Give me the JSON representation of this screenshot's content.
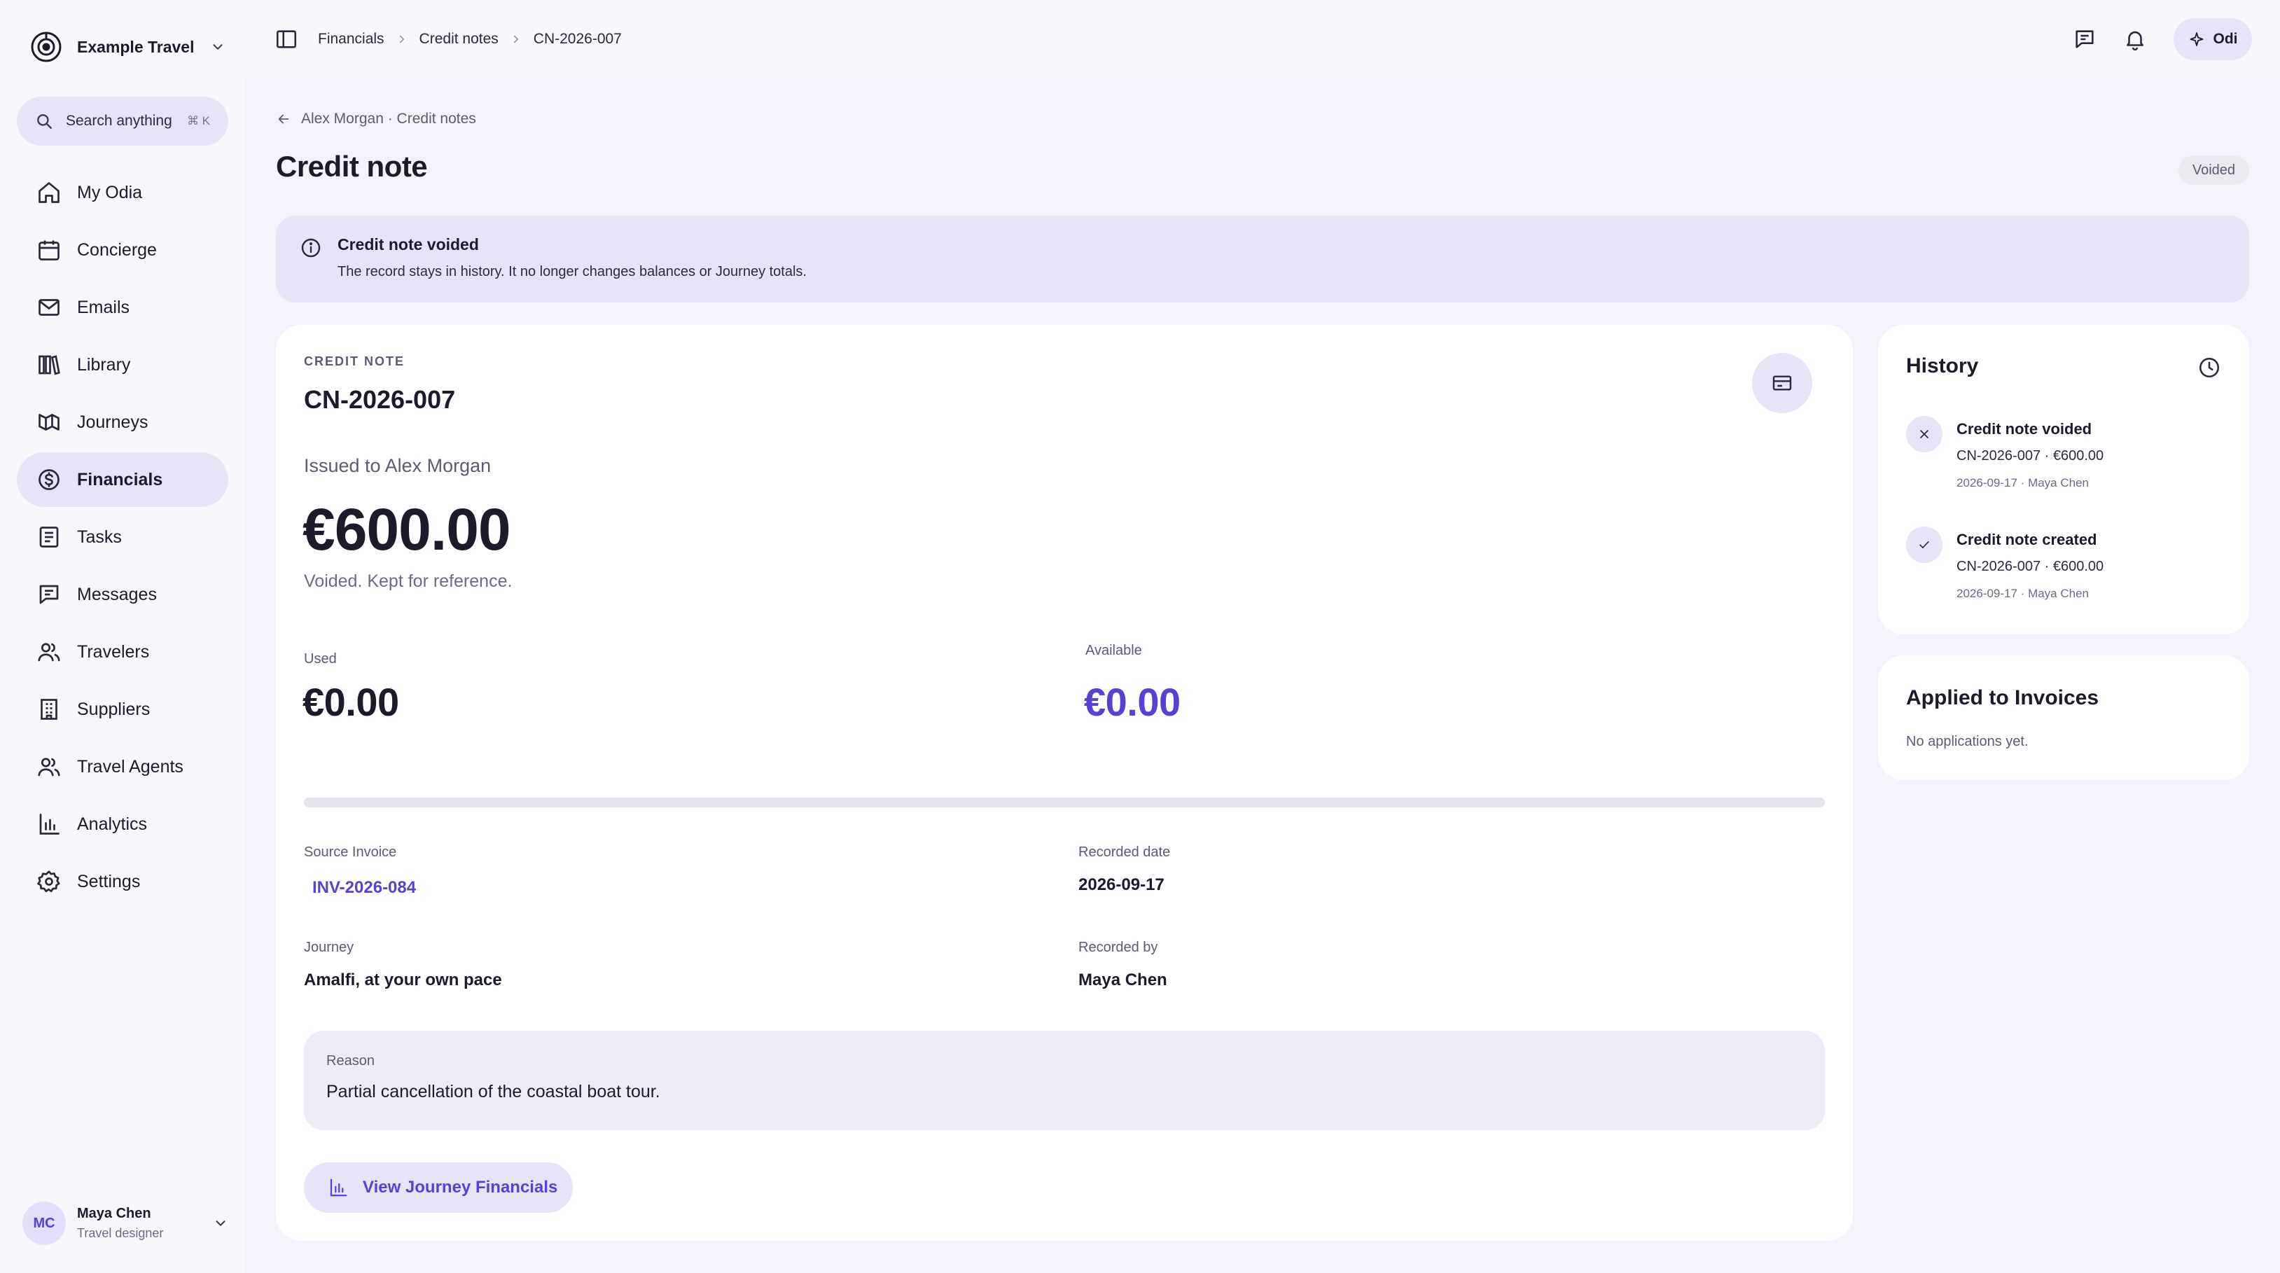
{
  "sidebar": {
    "brand": "Example Travel",
    "search": {
      "placeholder": "Search anything",
      "shortcut": "⌘ K"
    },
    "items": [
      {
        "label": "My Odia",
        "icon": "home-icon",
        "active": false
      },
      {
        "label": "Concierge",
        "icon": "calendar-icon",
        "active": false
      },
      {
        "label": "Emails",
        "icon": "mail-icon",
        "active": false
      },
      {
        "label": "Library",
        "icon": "library-icon",
        "active": false
      },
      {
        "label": "Journeys",
        "icon": "journeys-icon",
        "active": false
      },
      {
        "label": "Financials",
        "icon": "dollar-icon",
        "active": true
      },
      {
        "label": "Tasks",
        "icon": "tasks-icon",
        "active": false
      },
      {
        "label": "Messages",
        "icon": "message-icon",
        "active": false
      },
      {
        "label": "Travelers",
        "icon": "users-icon",
        "active": false
      },
      {
        "label": "Suppliers",
        "icon": "building-icon",
        "active": false
      },
      {
        "label": "Travel Agents",
        "icon": "agents-icon",
        "active": false
      },
      {
        "label": "Analytics",
        "icon": "bar-chart-icon",
        "active": false
      },
      {
        "label": "Settings",
        "icon": "gear-icon",
        "active": false
      }
    ],
    "user": {
      "initials": "MC",
      "name": "Maya Chen",
      "role": "Travel designer"
    }
  },
  "topbar": {
    "breadcrumbs": [
      "Financials",
      "Credit notes",
      "CN-2026-007"
    ],
    "assistant_label": "Odi"
  },
  "page": {
    "back_link": "Alex Morgan · Credit notes",
    "title": "Credit note",
    "status": "Voided"
  },
  "alert": {
    "title": "Credit note voided",
    "message": "The record stays in history. It no longer changes balances or Journey totals."
  },
  "credit_note": {
    "eyebrow": "CREDIT NOTE",
    "number": "CN-2026-007",
    "issued_to": "Issued to Alex Morgan",
    "amount": "€600.00",
    "amount_note": "Voided. Kept for reference.",
    "used_label": "Used",
    "used_value": "€0.00",
    "available_label": "Available",
    "available_value": "€0.00",
    "usage_fraction": 0,
    "source_invoice_label": "Source Invoice",
    "source_invoice": "INV-2026-084",
    "recorded_date_label": "Recorded date",
    "recorded_date": "2026-09-17",
    "journey_label": "Journey",
    "journey": "Amalfi, at your own pace",
    "recorded_by_label": "Recorded by",
    "recorded_by": "Maya Chen",
    "reason_label": "Reason",
    "reason": "Partial cancellation of the coastal boat tour.",
    "view_button": "View Journey Financials"
  },
  "history": {
    "title": "History",
    "items": [
      {
        "title": "Credit note voided",
        "summary": "CN-2026-007 · €600.00",
        "meta": "2026-09-17 · Maya Chen",
        "icon": "x-icon"
      },
      {
        "title": "Credit note created",
        "summary": "CN-2026-007 · €600.00",
        "meta": "2026-09-17 · Maya Chen",
        "icon": "check-icon"
      }
    ]
  },
  "applied": {
    "title": "Applied to Invoices",
    "empty": "No applications yet."
  },
  "colors": {
    "accent": "#5a3fd6",
    "surface_tint": "#e8e4f7",
    "background": "#f4f2fb"
  }
}
